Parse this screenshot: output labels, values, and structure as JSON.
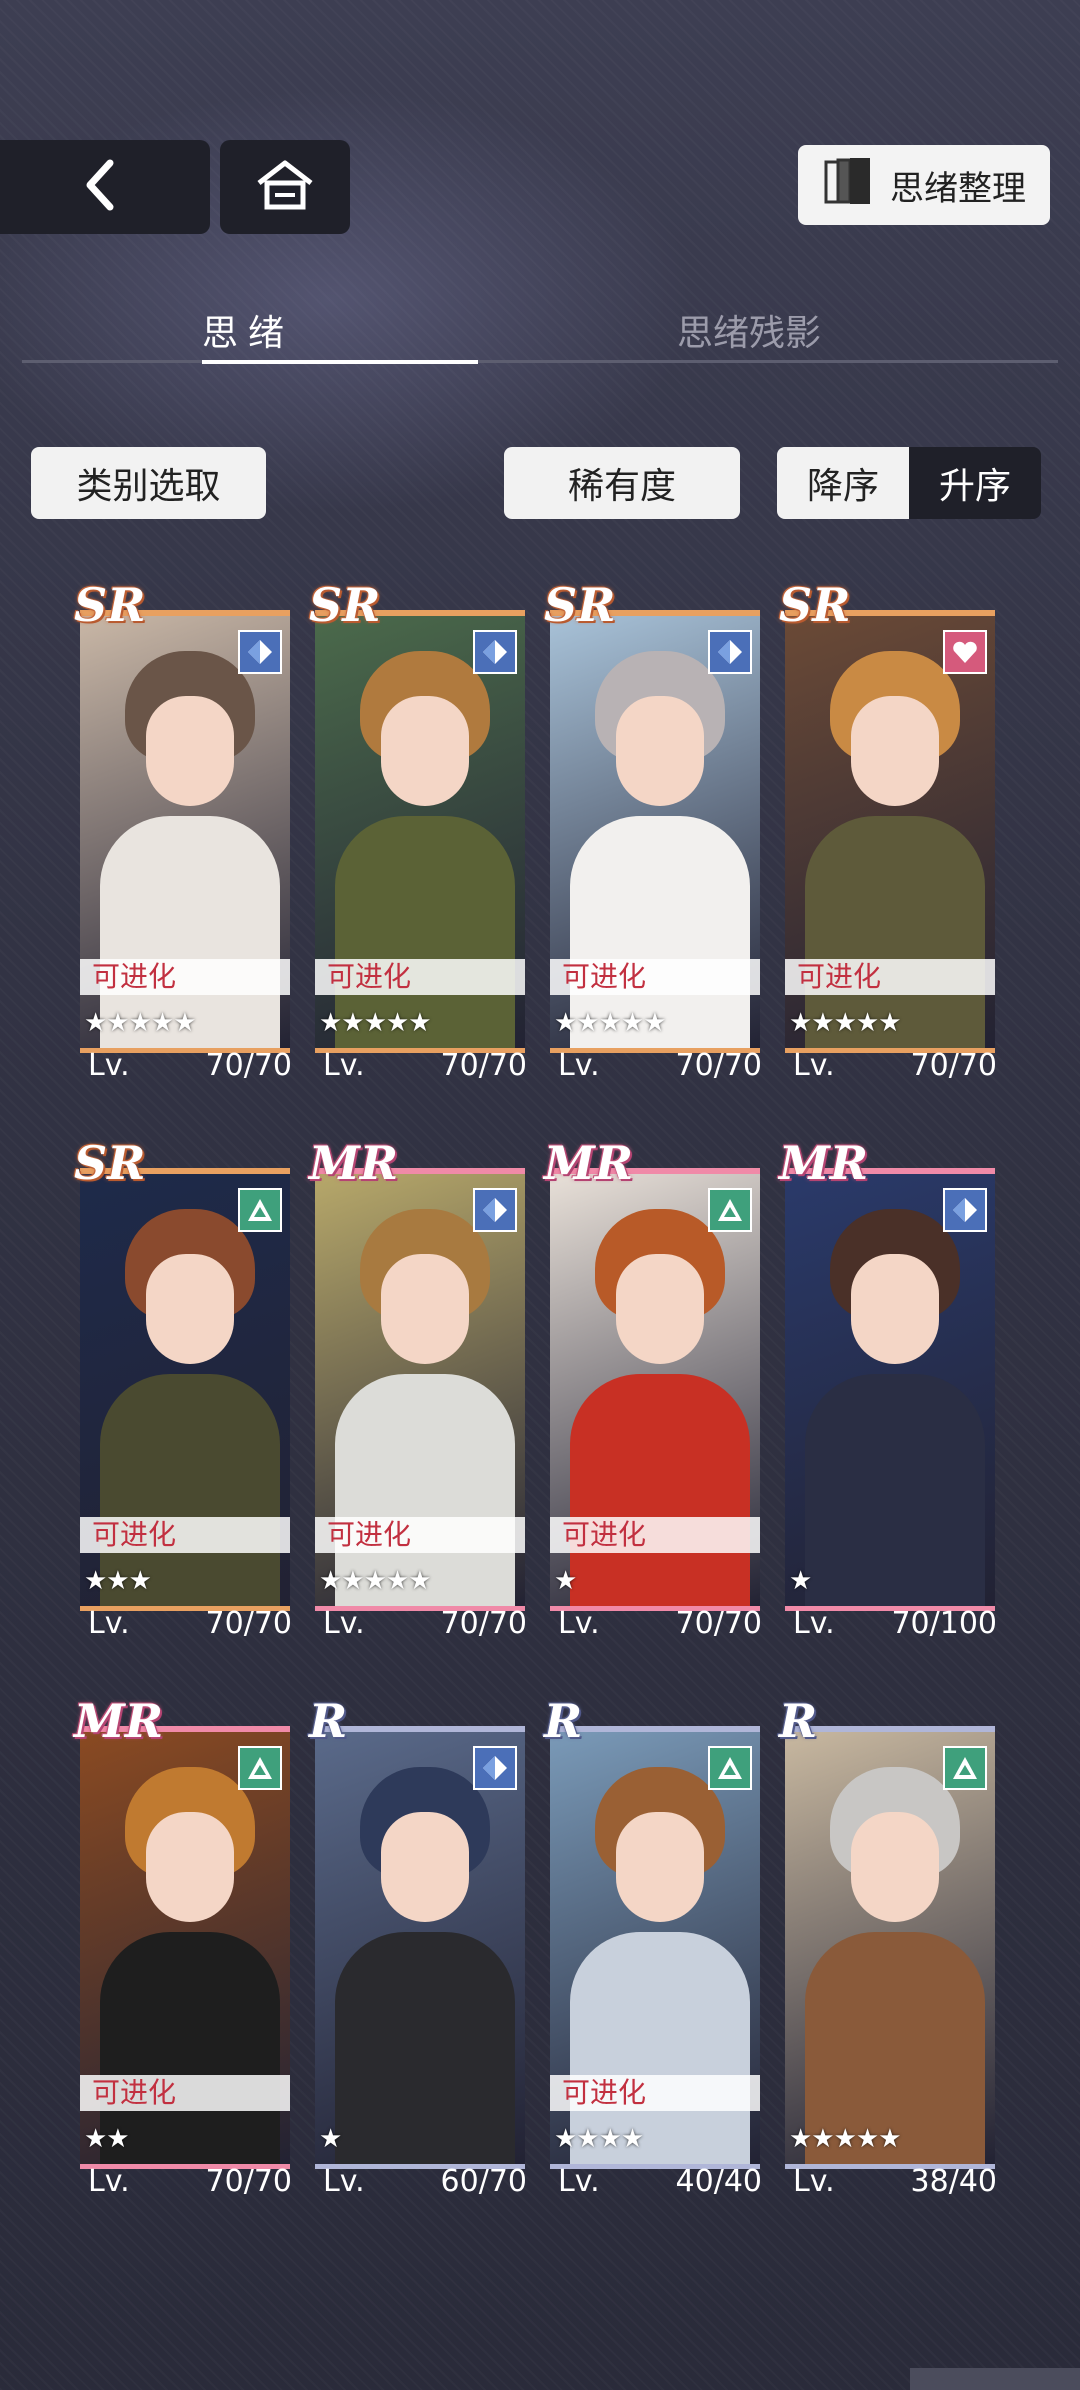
{
  "header": {
    "back_icon": "chevron-left-icon",
    "home_icon": "home-icon",
    "organize_label": "思绪整理",
    "organize_icon": "cards-stack-icon"
  },
  "tabs": [
    {
      "label": "思绪",
      "active": true
    },
    {
      "label": "思绪残影",
      "active": false
    }
  ],
  "toolbar": {
    "filter_label": "类别选取",
    "sort_field_label": "稀有度",
    "desc_label": "降序",
    "asc_label": "升序",
    "selected_order": "升序"
  },
  "cards": [
    {
      "rarity": "SR",
      "type_icon": "diamond-icon",
      "type_color": "#4b6fb8",
      "evolvable": "可进化",
      "stars": "★★★★★",
      "lv_label": "Lv.",
      "level": "70/70",
      "hair": "#6a5548",
      "outfit": "#e9e4df",
      "bg": "#c9b7a6"
    },
    {
      "rarity": "SR",
      "type_icon": "diamond-icon",
      "type_color": "#4b6fb8",
      "evolvable": "可进化",
      "stars": "★★★★★",
      "lv_label": "Lv.",
      "level": "70/70",
      "hair": "#b07a3e",
      "outfit": "#5b6236",
      "bg": "#4b6a4b"
    },
    {
      "rarity": "SR",
      "type_icon": "diamond-icon",
      "type_color": "#4b6fb8",
      "evolvable": "可进化",
      "stars": "★★★★★",
      "lv_label": "Lv.",
      "level": "70/70",
      "hair": "#b8b2b4",
      "outfit": "#f2f0ee",
      "bg": "#a8c2d8"
    },
    {
      "rarity": "SR",
      "type_icon": "heart-icon",
      "type_color": "#d55a7c",
      "evolvable": "可进化",
      "stars": "★★★★★",
      "lv_label": "Lv.",
      "level": "70/70",
      "hair": "#c98a44",
      "outfit": "#5e5a3a",
      "bg": "#6b4a36"
    },
    {
      "rarity": "SR",
      "type_icon": "triangle-icon",
      "type_color": "#3fa07c",
      "evolvable": "可进化",
      "stars": "★★★",
      "lv_label": "Lv.",
      "level": "70/70",
      "hair": "#8a4a2e",
      "outfit": "#4a4a30",
      "bg": "#1e2a4a"
    },
    {
      "rarity": "MR",
      "type_icon": "diamond-icon",
      "type_color": "#4b6fb8",
      "evolvable": "可进化",
      "stars": "★★★★★",
      "lv_label": "Lv.",
      "level": "70/70",
      "hair": "#a87a40",
      "outfit": "#dcdcd8",
      "bg": "#b7a86a"
    },
    {
      "rarity": "MR",
      "type_icon": "triangle-icon",
      "type_color": "#3fa07c",
      "evolvable": "可进化",
      "stars": "★",
      "lv_label": "Lv.",
      "level": "70/70",
      "hair": "#b85a28",
      "outfit": "#c83024",
      "bg": "#e8e0d8"
    },
    {
      "rarity": "MR",
      "type_icon": "diamond-icon",
      "type_color": "#4b6fb8",
      "evolvable": "",
      "stars": "★",
      "lv_label": "Lv.",
      "level": "70/100",
      "hair": "#4a3028",
      "outfit": "#2a2e44",
      "bg": "#2a3a6a"
    },
    {
      "rarity": "MR",
      "type_icon": "triangle-icon",
      "type_color": "#3fa07c",
      "evolvable": "可进化",
      "stars": "★★",
      "lv_label": "Lv.",
      "level": "70/70",
      "hair": "#c07a30",
      "outfit": "#1e1e1e",
      "bg": "#8a4a22"
    },
    {
      "rarity": "R",
      "type_icon": "diamond-icon",
      "type_color": "#4b6fb8",
      "evolvable": "",
      "stars": "★",
      "lv_label": "Lv.",
      "level": "60/70",
      "hair": "#2e3a5a",
      "outfit": "#2a2a2e",
      "bg": "#5a6a8a"
    },
    {
      "rarity": "R",
      "type_icon": "triangle-icon",
      "type_color": "#3fa07c",
      "evolvable": "可进化",
      "stars": "★★★★",
      "lv_label": "Lv.",
      "level": "40/40",
      "hair": "#9a6034",
      "outfit": "#c8d0dc",
      "bg": "#7a9ab8"
    },
    {
      "rarity": "R",
      "type_icon": "triangle-icon",
      "type_color": "#3fa07c",
      "evolvable": "",
      "stars": "★★★★★",
      "lv_label": "Lv.",
      "level": "38/40",
      "hair": "#c8c6c4",
      "outfit": "#8a5a3a",
      "bg": "#c8b8a0"
    }
  ]
}
